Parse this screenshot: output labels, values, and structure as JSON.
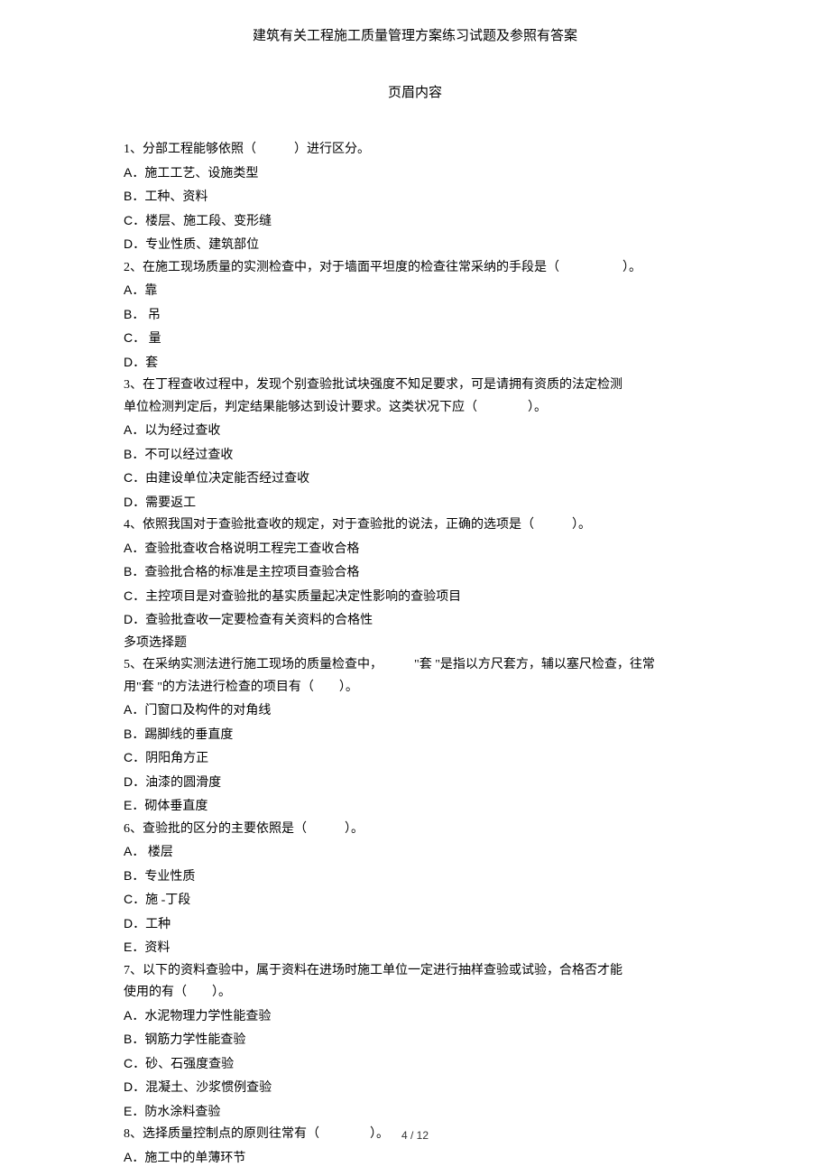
{
  "page_title": "建筑有关工程施工质量管理方案练习试题及参照有答案",
  "header_label": "页眉内容",
  "lines": [
    "1、分部工程能够依照（　　　）进行区分。",
    "A．施工工艺、设施类型",
    "B．工种、资料",
    "C．楼层、施工段、变形缝",
    "D．专业性质、建筑部位",
    "2、在施工现场质量的实测检查中，对于墙面平坦度的检查往常采纳的手段是（　　　　　）。",
    "A．靠",
    "B． 吊",
    "C． 量",
    "D．套",
    "3、在丁程查收过程中，发现个别查验批试块强度不知足要求，可是请拥有资质的法定检测",
    "单位检测判定后，判定结果能够达到设计要求。这类状况下应（　　　　）。",
    "A．以为经过查收",
    "B．不可以经过查收",
    "C．由建设单位决定能否经过查收",
    "D．需要返工",
    "4、依照我国对于查验批查收的规定，对于查验批的说法，正确的选项是（　　　）。",
    "A．查验批查收合格说明工程完工查收合格",
    "B．查验批合格的标准是主控项目查验合格",
    "C．主控项目是对查验批的基实质量起决定性影响的查验项目",
    "D．查验批查收一定要检查有关资料的合格性",
    "多项选择题",
    "5、在采纳实测法进行施工现场的质量检查中，　　　\"套 \"是指以方尺套方，辅以塞尺检查，往常",
    "用\"套 \"的方法进行检查的项目有（　　）。",
    "A．门窗口及构件的对角线",
    "B．踢脚线的垂直度",
    "C．阴阳角方正",
    "D．油漆的圆滑度",
    "E．砌体垂直度",
    "6、查验批的区分的主要依照是（　　　）。",
    "A． 楼层",
    "B．专业性质",
    "C．施 -丁段",
    "D．工种",
    "E．资料",
    "7、以下的资料查验中，属于资料在进场时施工单位一定进行抽样查验或试验，合格否才能",
    "使用的有（　　）。",
    "A．水泥物理力学性能查验",
    "B．钢筋力学性能查验",
    "C．砂、石强度查验",
    "D．混凝土、沙浆惯例查验",
    "E．防水涂料查验",
    "8、选择质量控制点的原则往常有（　　　　）。",
    "A．施工中的单薄环节"
  ],
  "page_number": "4 / 12"
}
